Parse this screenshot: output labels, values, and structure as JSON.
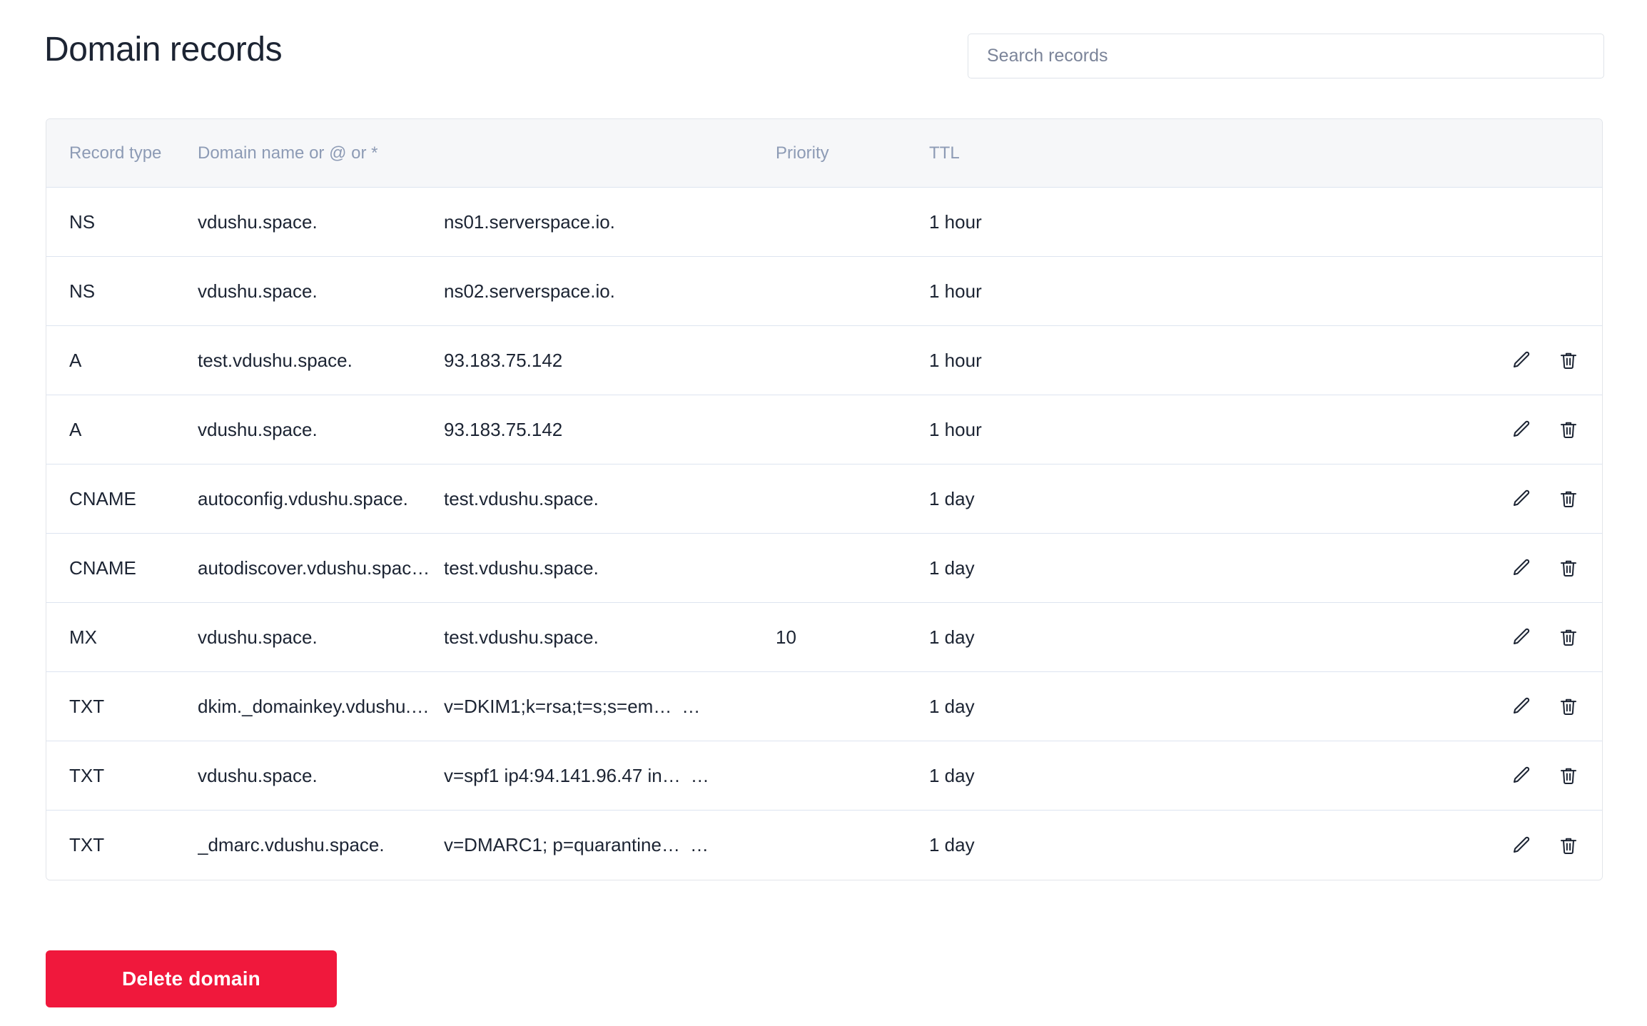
{
  "header": {
    "title": "Domain records"
  },
  "search": {
    "placeholder": "Search records",
    "value": ""
  },
  "table": {
    "columns": {
      "record_type": "Record type",
      "domain_name": "Domain name or @ or *",
      "value": "",
      "priority": "Priority",
      "ttl": "TTL"
    },
    "rows": [
      {
        "record_type": "NS",
        "domain_name": "vdushu.space.",
        "value": "ns01.serverspace.io.",
        "value_truncated": false,
        "priority": "",
        "ttl": "1 hour",
        "has_actions": false
      },
      {
        "record_type": "NS",
        "domain_name": "vdushu.space.",
        "value": "ns02.serverspace.io.",
        "value_truncated": false,
        "priority": "",
        "ttl": "1 hour",
        "has_actions": false
      },
      {
        "record_type": "A",
        "domain_name": "test.vdushu.space.",
        "value": "93.183.75.142",
        "value_truncated": false,
        "priority": "",
        "ttl": "1 hour",
        "has_actions": true
      },
      {
        "record_type": "A",
        "domain_name": "vdushu.space.",
        "value": "93.183.75.142",
        "value_truncated": false,
        "priority": "",
        "ttl": "1 hour",
        "has_actions": true
      },
      {
        "record_type": "CNAME",
        "domain_name": "autoconfig.vdushu.space.",
        "value": "test.vdushu.space.",
        "value_truncated": false,
        "priority": "",
        "ttl": "1 day",
        "has_actions": true
      },
      {
        "record_type": "CNAME",
        "domain_name": "autodiscover.vdushu.spac…",
        "value": "test.vdushu.space.",
        "value_truncated": false,
        "priority": "",
        "ttl": "1 day",
        "has_actions": true
      },
      {
        "record_type": "MX",
        "domain_name": "vdushu.space.",
        "value": "test.vdushu.space.",
        "value_truncated": false,
        "priority": "10",
        "ttl": "1 day",
        "has_actions": true
      },
      {
        "record_type": "TXT",
        "domain_name": "dkim._domainkey.vdushu.…",
        "value": "v=DKIM1;k=rsa;t=s;s=em…",
        "value_truncated": true,
        "priority": "",
        "ttl": "1 day",
        "has_actions": true
      },
      {
        "record_type": "TXT",
        "domain_name": "vdushu.space.",
        "value": "v=spf1 ip4:94.141.96.47 in…",
        "value_truncated": true,
        "priority": "",
        "ttl": "1 day",
        "has_actions": true
      },
      {
        "record_type": "TXT",
        "domain_name": "_dmarc.vdushu.space.",
        "value": "v=DMARC1; p=quarantine…",
        "value_truncated": true,
        "priority": "",
        "ttl": "1 day",
        "has_actions": true
      }
    ],
    "truncation_marker": "…",
    "row_actions": {
      "edit_label": "Edit record",
      "delete_label": "Delete record"
    }
  },
  "footer": {
    "delete_domain_label": "Delete domain"
  },
  "colors": {
    "danger": "#f0183c",
    "header_bg": "#f6f7f9",
    "header_text": "#8d9bb5",
    "body_text": "#1c2433",
    "divider": "#dde4f0",
    "border": "#e2e5ea"
  }
}
